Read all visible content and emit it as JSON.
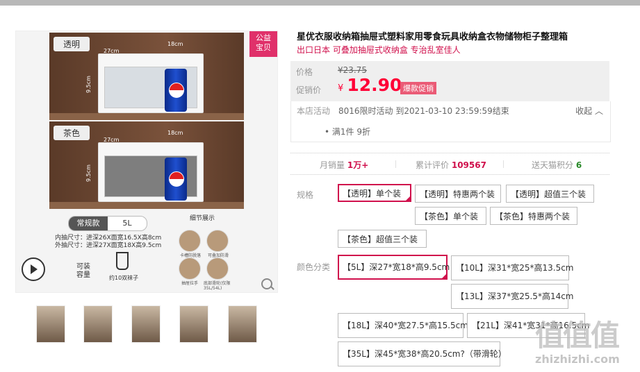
{
  "gallery": {
    "tag_transparent": "透明",
    "tag_tea": "茶色",
    "dim_width": "18cm",
    "dim_depth": "27cm",
    "dim_height": "9.5cm",
    "badge": "公益\n宝贝",
    "toggle": [
      "常规款",
      "5L"
    ],
    "spec_inner": "内抽尺寸：进深26X面宽16.5X高8cm",
    "spec_outer": "外抽尺寸：进深27X面宽18X高9.5cm",
    "detail_title": "细节展示",
    "details": [
      "卡槽防脱落",
      "可叠加防滑",
      "抽屉拉手",
      "底部滑轮(仅限35L/54L)"
    ],
    "capacity_label": "可装\n容量",
    "sock_label": "约10双袜子",
    "play_icon": "play-icon",
    "zoom_icon": "magnifier-icon"
  },
  "thumbnails": [
    {
      "name": "thumb-1"
    },
    {
      "name": "thumb-2"
    },
    {
      "name": "thumb-3"
    },
    {
      "name": "thumb-4"
    },
    {
      "name": "thumb-5"
    }
  ],
  "product": {
    "title": "星优衣服收纳箱抽屉式塑料家用零食玩具收纳盒衣物储物柜子整理箱",
    "subtitle": "出口日本 可叠加抽屉式收纳盒 专治乱室佳人"
  },
  "price": {
    "label_price": "价格",
    "old": "¥23.75",
    "label_promo": "促销价",
    "currency": "¥",
    "new": "12.90",
    "promo_tag": "爆款促销"
  },
  "activity": {
    "label": "本店活动",
    "text": "8016限时活动 到2021-03-10 23:59:59结束",
    "collapse": "收起",
    "item": "满1件 9折"
  },
  "stats": {
    "monthly_label": "月销量",
    "monthly_value": "1万+",
    "reviews_label": "累计评价",
    "reviews_value": "109567",
    "points_label": "送天猫积分",
    "points_value": "6"
  },
  "spec": {
    "label": "规格",
    "options": [
      "【透明】单个装",
      "【透明】特惠两个装",
      "【透明】超值三个装",
      "【茶色】单个装",
      "【茶色】特惠两个装",
      "【茶色】超值三个装"
    ],
    "selected": 0
  },
  "color": {
    "label": "颜色分类",
    "options": [
      "【5L】深27*宽18*高9.5cm",
      "【10L】深31*宽25*高13.5cm",
      "【13L】深37*宽25.5*高14cm",
      "【18L】深40*宽27.5*高15.5cm",
      "【21L】深41*宽31*高16.5cm",
      "【35L】深45*宽38*高20.5cm?（带滑轮）"
    ],
    "selected": 0
  },
  "watermark": {
    "logo": "值值值",
    "url": "zhizhizhi.com"
  },
  "colors": {
    "accent": "#d0104c",
    "price_red": "#ff0036",
    "promo_pink": "#ea5b76"
  }
}
